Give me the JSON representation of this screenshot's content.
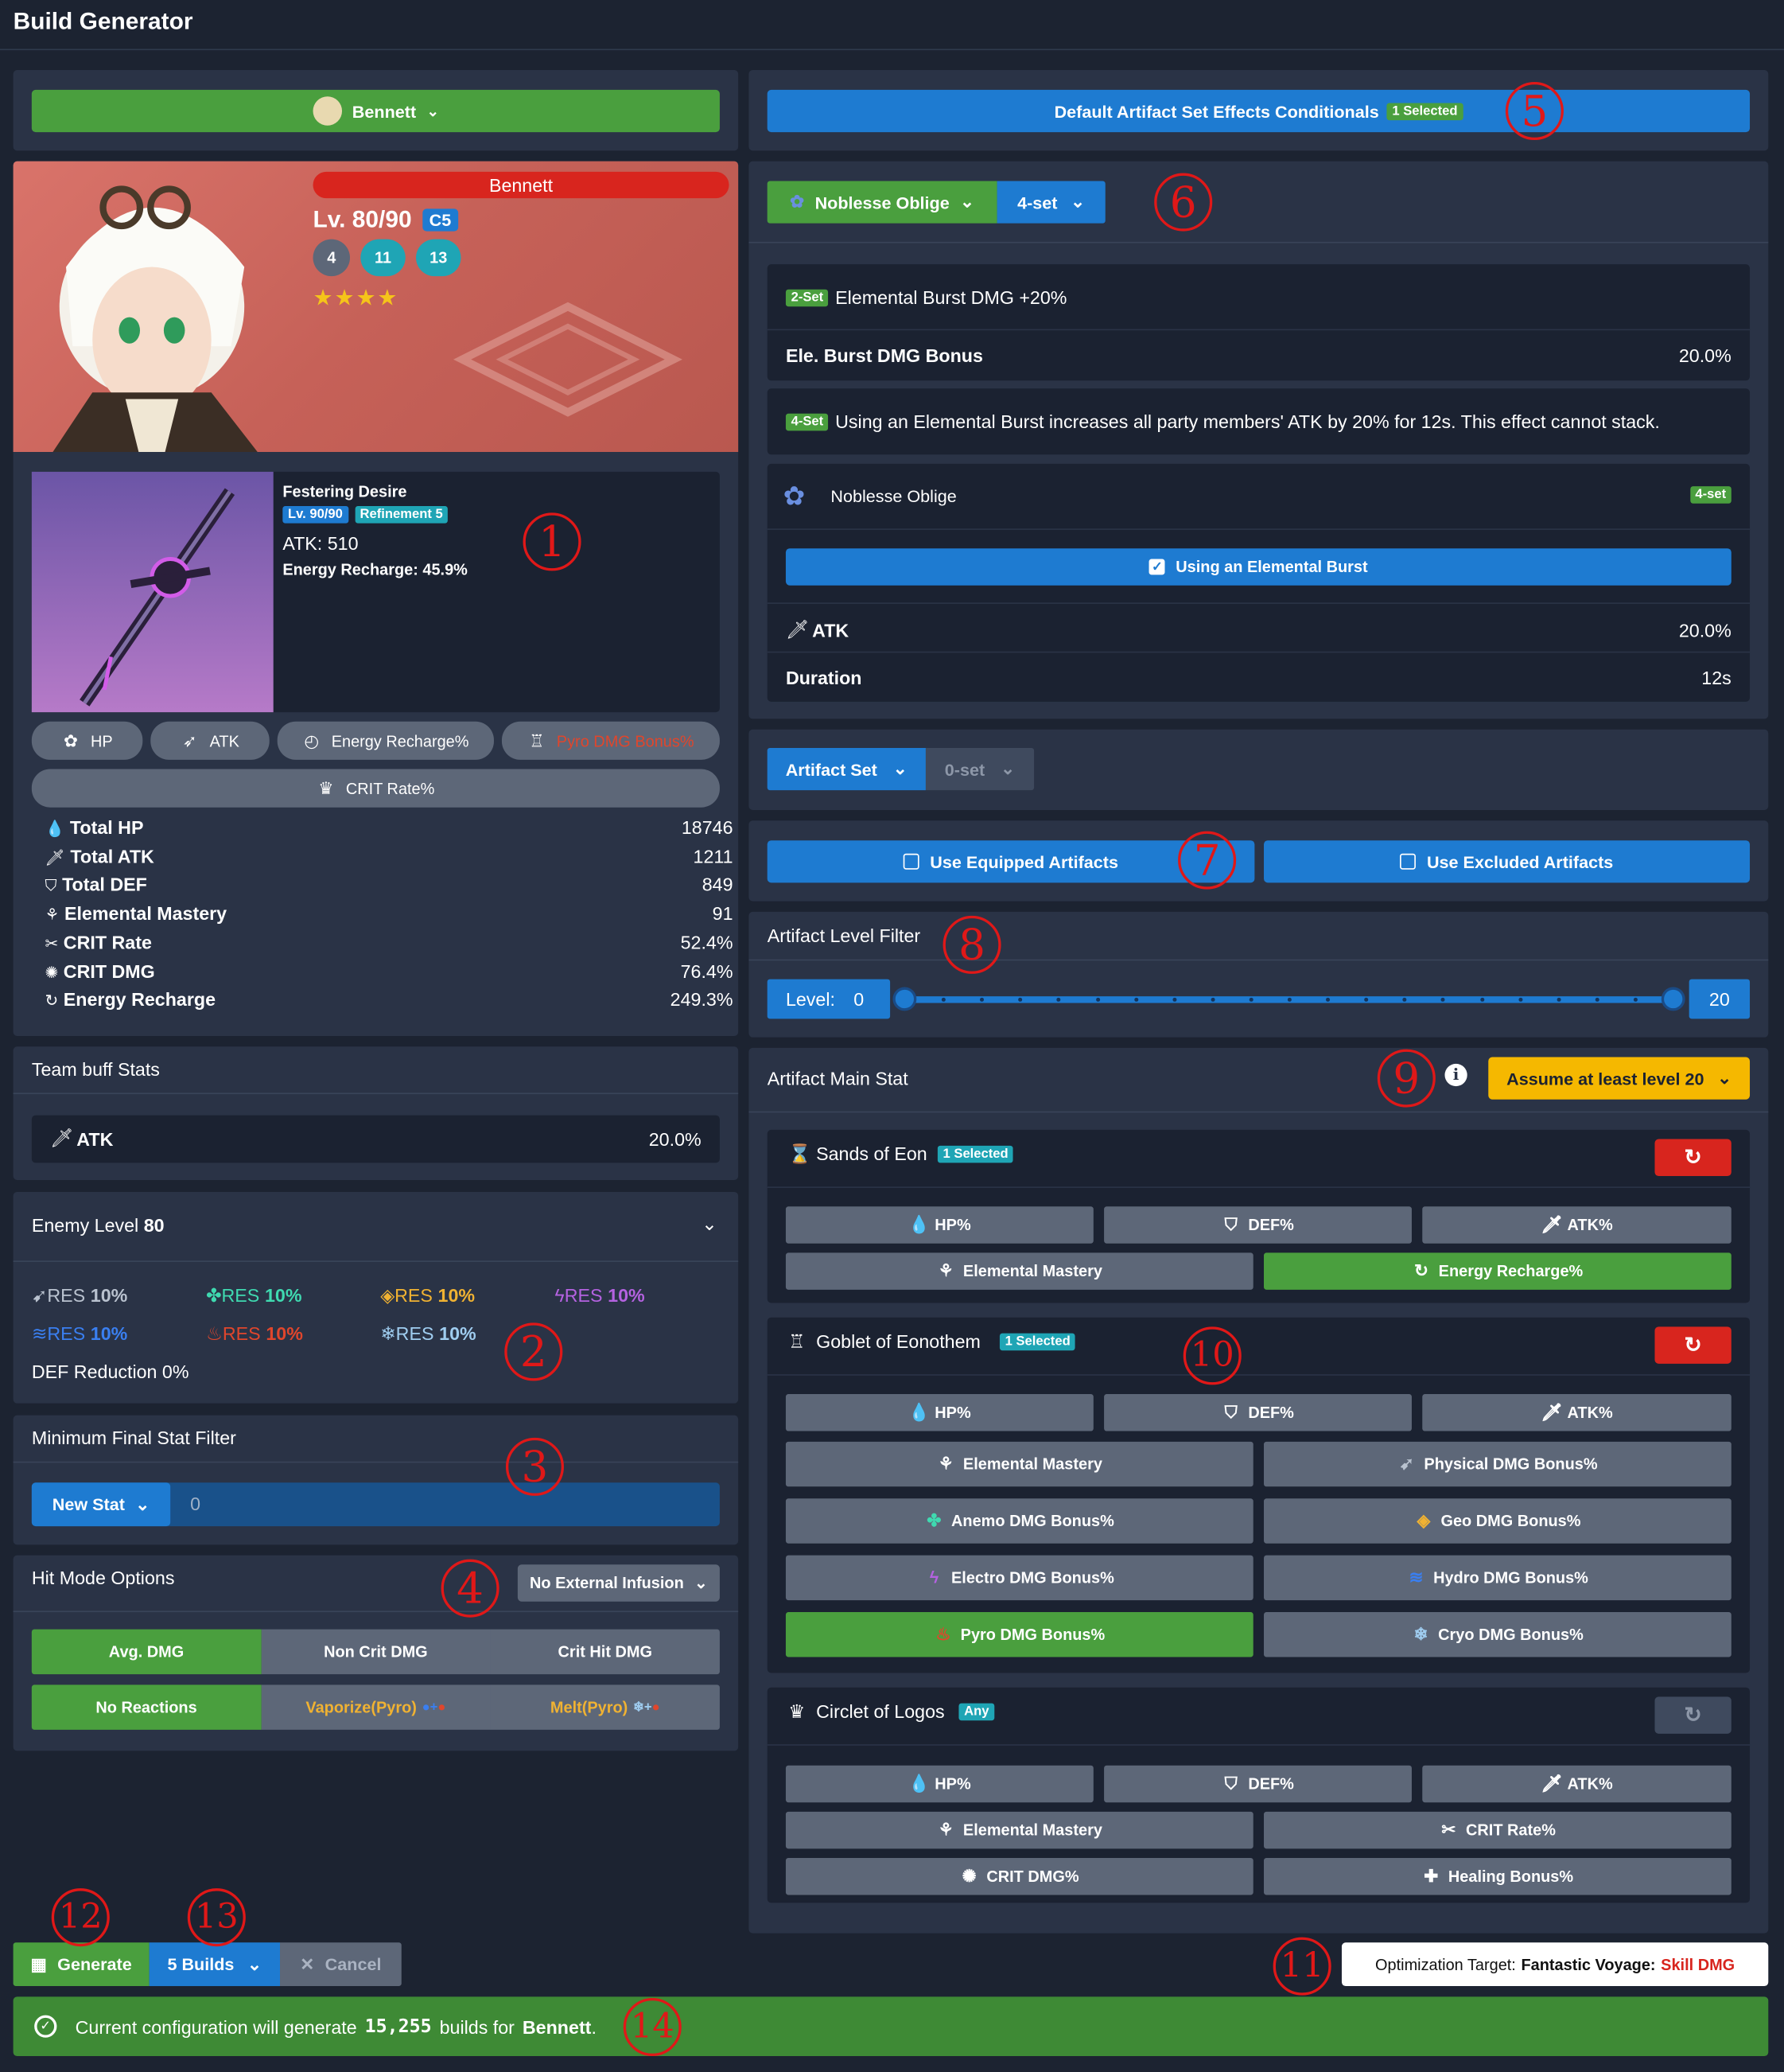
{
  "app": {
    "title": "Build Generator"
  },
  "character": {
    "select_label": "Bennett",
    "name": "Bennett",
    "level": "Lv. 80/90",
    "constellation": "C5",
    "talents": [
      "4",
      "11",
      "13"
    ],
    "stars": "★★★★",
    "stats": [
      {
        "label": "Total HP",
        "value": "18746",
        "icon": "hp-icon"
      },
      {
        "label": "Total ATK",
        "value": "1211",
        "icon": "atk-icon"
      },
      {
        "label": "Total DEF",
        "value": "849",
        "icon": "def-icon"
      },
      {
        "label": "Elemental Mastery",
        "value": "91",
        "icon": "em-icon"
      },
      {
        "label": "CRIT Rate",
        "value": "52.4%",
        "icon": "crit-rate-icon"
      },
      {
        "label": "CRIT DMG",
        "value": "76.4%",
        "icon": "crit-dmg-icon"
      },
      {
        "label": "Energy Recharge",
        "value": "249.3%",
        "icon": "er-icon"
      }
    ]
  },
  "weapon": {
    "name": "Festering Desire",
    "level": "Lv. 90/90",
    "refinement": "Refinement 5",
    "atk": "ATK: 510",
    "substat": "Energy Recharge: 45.9%"
  },
  "artifact_chips": [
    {
      "label": "HP",
      "color": "#ffffff"
    },
    {
      "label": "ATK",
      "color": "#ffffff"
    },
    {
      "label": "Energy Recharge%",
      "color": "#ffffff"
    },
    {
      "label": "Pyro DMG Bonus%",
      "color": "#e0462c"
    },
    {
      "label": "CRIT Rate%",
      "color": "#ffffff"
    }
  ],
  "team_buff": {
    "title": "Team buff Stats",
    "stat_label": "ATK",
    "stat_value": "20.0%"
  },
  "enemy": {
    "label": "Enemy Level",
    "level": "80",
    "res": [
      {
        "prefix": "RES",
        "value": "10%",
        "color": "#b9c2cf"
      },
      {
        "prefix": "RES",
        "value": "10%",
        "color": "#3fd9b0"
      },
      {
        "prefix": "RES",
        "value": "10%",
        "color": "#f0b232"
      },
      {
        "prefix": "RES",
        "value": "10%",
        "color": "#b462e0"
      },
      {
        "prefix": "RES",
        "value": "10%",
        "color": "#3a7ff0"
      },
      {
        "prefix": "RES",
        "value": "10%",
        "color": "#e0462c"
      },
      {
        "prefix": "RES",
        "value": "10%",
        "color": "#9fcdf0"
      }
    ],
    "def_reduction": "DEF Reduction 0%"
  },
  "min_filter": {
    "title": "Minimum Final Stat Filter",
    "new_stat": "New Stat",
    "value": "0"
  },
  "hit_mode": {
    "title": "Hit Mode Options",
    "infusion": "No External Infusion",
    "modes": [
      "Avg. DMG",
      "Non Crit DMG",
      "Crit Hit DMG"
    ],
    "reactions": [
      "No Reactions",
      "Vaporize(Pyro)",
      "Melt(Pyro)"
    ]
  },
  "bottom": {
    "generate": "Generate",
    "builds": "5 Builds",
    "cancel": "Cancel",
    "target_prefix": "Optimization Target:",
    "target_name": "Fantastic Voyage:",
    "target_value": "Skill DMG",
    "status_pre": "Current configuration will generate",
    "status_count": "15,255",
    "status_mid": "builds for",
    "status_char": "Bennett",
    "status_end": "."
  },
  "set_effects": {
    "button": "Default Artifact Set Effects Conditionals",
    "badge": "1 Selected",
    "set_name": "Noblesse Oblige",
    "set_count": "4-set",
    "two_tag": "2-Set",
    "two_text": "Elemental Burst DMG +20%",
    "two_stat": "Ele. Burst DMG Bonus",
    "two_value": "20.0%",
    "four_tag": "4-Set",
    "four_text": "Using an Elemental Burst increases all party members' ATK by 20% for 12s. This effect cannot stack.",
    "cond_set": "Noblesse Oblige",
    "cond_tag": "4-set",
    "cond_button": "Using an Elemental Burst",
    "atk_label": "ATK",
    "atk_value": "20.0%",
    "duration_label": "Duration",
    "duration_value": "12s"
  },
  "artifact_set": {
    "label": "Artifact Set",
    "count": "0-set"
  },
  "use": {
    "equipped": "Use Equipped Artifacts",
    "excluded": "Use Excluded Artifacts"
  },
  "level_filter": {
    "title": "Artifact Level Filter",
    "label": "Level:",
    "min": "0",
    "max": "20",
    "range_fraction": [
      0,
      1
    ]
  },
  "main_stat": {
    "title": "Artifact Main Stat",
    "assume": "Assume at least level 20",
    "sands": {
      "title": "Sands of Eon",
      "badge": "1 Selected",
      "row1": [
        "HP%",
        "DEF%",
        "ATK%"
      ],
      "row2": [
        "Elemental Mastery",
        "Energy Recharge%"
      ]
    },
    "goblet": {
      "title": "Goblet of Eonothem",
      "badge": "1 Selected",
      "row1": [
        "HP%",
        "DEF%",
        "ATK%"
      ],
      "pairs": [
        [
          "Elemental Mastery",
          "Physical DMG Bonus%"
        ],
        [
          "Anemo DMG Bonus%",
          "Geo DMG Bonus%"
        ],
        [
          "Electro DMG Bonus%",
          "Hydro DMG Bonus%"
        ],
        [
          "Pyro DMG Bonus%",
          "Cryo DMG Bonus%"
        ]
      ]
    },
    "circlet": {
      "title": "Circlet of Logos",
      "badge": "Any",
      "row1": [
        "HP%",
        "DEF%",
        "ATK%"
      ],
      "pairs": [
        [
          "Elemental Mastery",
          "CRIT Rate%"
        ],
        [
          "CRIT DMG%",
          "Healing Bonus%"
        ]
      ]
    }
  },
  "annotations": [
    "1",
    "2",
    "3",
    "4",
    "5",
    "6",
    "7",
    "8",
    "9",
    "10",
    "11",
    "12",
    "13",
    "14"
  ]
}
